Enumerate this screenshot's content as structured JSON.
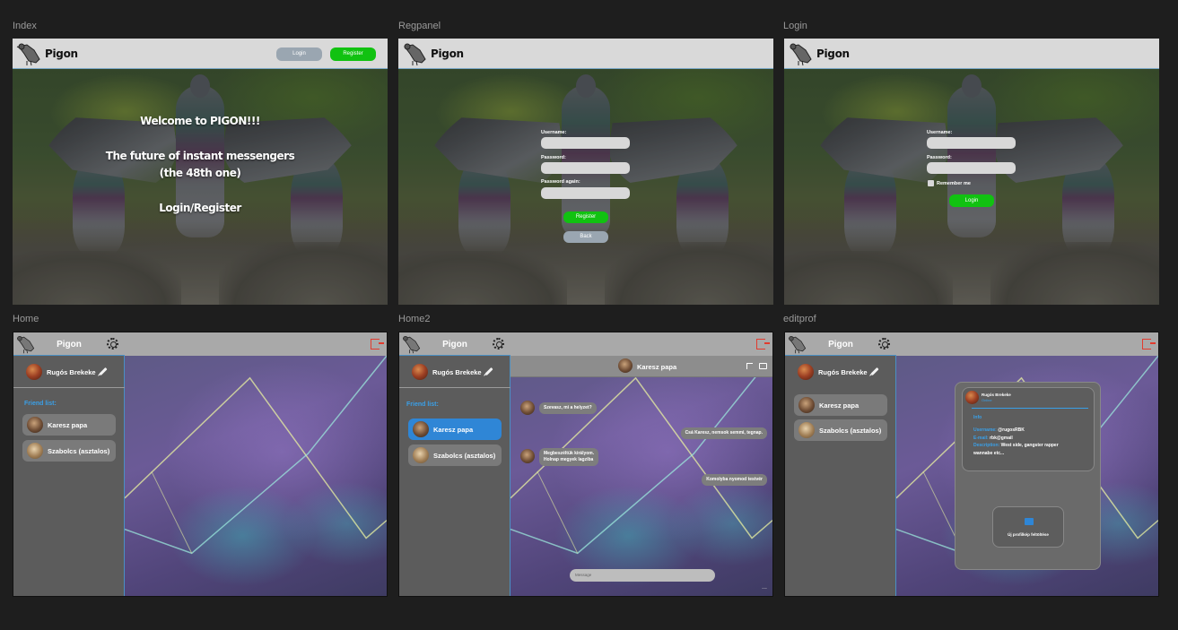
{
  "frames": {
    "index": {
      "label": "Index"
    },
    "regpanel": {
      "label": "Regpanel"
    },
    "login": {
      "label": "Login"
    },
    "home": {
      "label": "Home"
    },
    "home2": {
      "label": "Home2"
    },
    "editprof": {
      "label": "editprof"
    }
  },
  "brand": "Pigon",
  "index": {
    "login_button": "Login",
    "register_button": "Register",
    "welcome": "Welcome to PIGON!!!",
    "future_line1": "The future of instant messengers",
    "future_line2": "(the 48th one)",
    "login_register": "Login/Register"
  },
  "regpanel": {
    "username_label": "Username:",
    "password_label": "Password:",
    "password_again_label": "Password again:",
    "register_button": "Register",
    "back_button": "Back"
  },
  "login": {
    "username_label": "Username:",
    "password_label": "Password:",
    "remember_label": "Remember me",
    "login_button": "Login"
  },
  "app": {
    "title": "Pigon",
    "user_name": "Rugós Brekeke",
    "friend_list_title": "Friend list:",
    "friends": [
      "Karesz papa",
      "Szabolcs (asztalos)"
    ]
  },
  "chat": {
    "contact": "Karesz papa",
    "messages": [
      {
        "text": "Szevasz, mi a helyzet?"
      },
      {
        "text": "Csá Karesz, nemsok semmi, tegnap."
      },
      {
        "text": "Megbeszéltük királyom."
      },
      {
        "text": "Holnap megyek lagziba"
      },
      {
        "text": "Komolyba nyomod testvér"
      }
    ],
    "input_placeholder": "Message",
    "more": "..."
  },
  "editprof": {
    "card_name": "Rugós Brekeke",
    "card_status": "Online",
    "info_title": "Info",
    "username_key": "Username:",
    "username_val": "@rugosRBK",
    "email_key": "E-mail:",
    "email_val": "rbk@gmail",
    "desc_key": "Description:",
    "desc_val": "West side, gangster rapper",
    "desc_val2": "wannabe etc...",
    "upload_label": "Új profilkép feltöltése"
  },
  "colors": {
    "accent": "#3aa0e8",
    "green": "#1ec21e",
    "logout": "#e23b2e"
  }
}
